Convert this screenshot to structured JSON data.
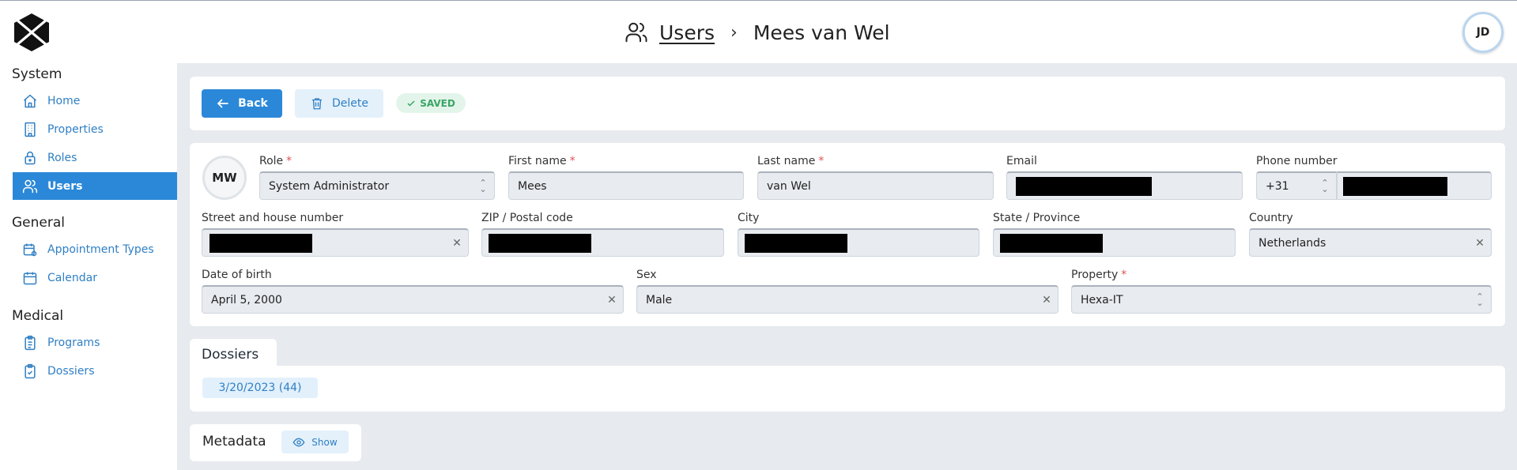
{
  "breadcrumb": {
    "parent": "Users",
    "separator": "›",
    "current": "Mees van Wel"
  },
  "header": {
    "user_initials": "JD"
  },
  "sidebar": {
    "sections": [
      {
        "heading": "System",
        "items": [
          {
            "label": "Home",
            "icon": "home-icon"
          },
          {
            "label": "Properties",
            "icon": "building-icon"
          },
          {
            "label": "Roles",
            "icon": "lock-icon"
          },
          {
            "label": "Users",
            "icon": "users-icon",
            "active": true
          }
        ]
      },
      {
        "heading": "General",
        "items": [
          {
            "label": "Appointment Types",
            "icon": "calendar-gear-icon"
          },
          {
            "label": "Calendar",
            "icon": "calendar-icon"
          }
        ]
      },
      {
        "heading": "Medical",
        "items": [
          {
            "label": "Programs",
            "icon": "clipboard-list-icon"
          },
          {
            "label": "Dossiers",
            "icon": "clipboard-check-icon"
          }
        ]
      }
    ]
  },
  "toolbar": {
    "back_label": "Back",
    "delete_label": "Delete",
    "saved_label": "SAVED"
  },
  "form": {
    "avatar_initials": "MW",
    "role": {
      "label": "Role",
      "required": "*",
      "value": "System Administrator"
    },
    "first_name": {
      "label": "First name",
      "required": "*",
      "value": "Mees"
    },
    "last_name": {
      "label": "Last name",
      "required": "*",
      "value": "van Wel"
    },
    "email": {
      "label": "Email"
    },
    "phone": {
      "label": "Phone number",
      "country_code": "+31"
    },
    "street": {
      "label": "Street and house number"
    },
    "zip": {
      "label": "ZIP / Postal code"
    },
    "city": {
      "label": "City"
    },
    "state": {
      "label": "State / Province"
    },
    "country": {
      "label": "Country",
      "value": "Netherlands"
    },
    "dob": {
      "label": "Date of birth",
      "value": "April 5, 2000"
    },
    "sex": {
      "label": "Sex",
      "value": "Male"
    },
    "property": {
      "label": "Property",
      "required": "*",
      "value": "Hexa-IT"
    }
  },
  "dossiers": {
    "title": "Dossiers",
    "items": [
      "3/20/2023 (44)"
    ]
  },
  "metadata": {
    "title": "Metadata",
    "show_label": "Show"
  },
  "colors": {
    "accent": "#2b88d8",
    "link": "#2f7fc4",
    "background": "#e7eaee",
    "success": "#3aa566",
    "required": "#e05252"
  }
}
